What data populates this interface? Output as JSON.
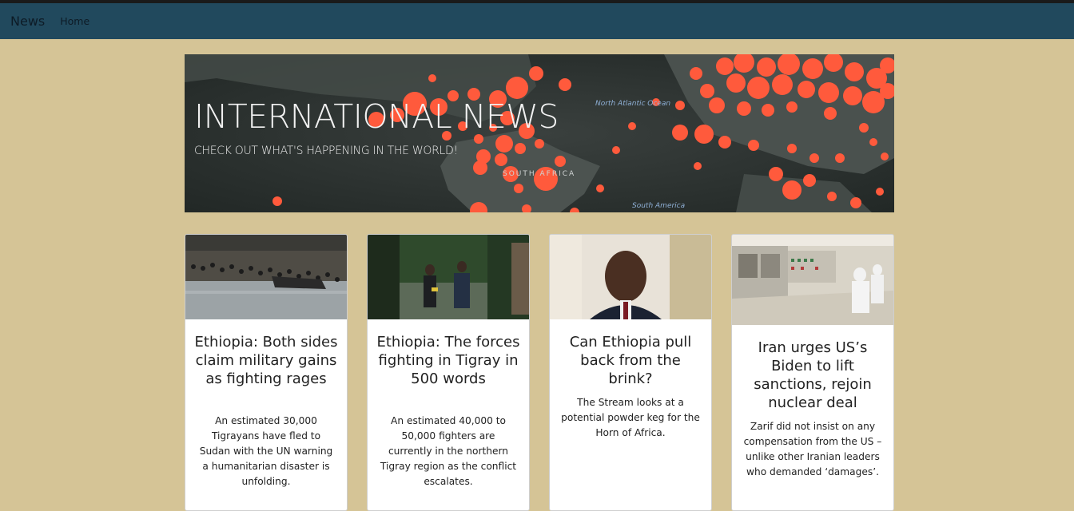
{
  "navbar": {
    "brand": "News",
    "home_label": "Home"
  },
  "hero": {
    "title": "INTERNATIONAL NEWS",
    "subtitle": "CHECK OUT WHAT'S HAPPENING IN THE WORLD!",
    "map_labels": [
      "North Atlantic Ocean",
      "SOUTH AFRICA",
      "South America"
    ]
  },
  "cards": [
    {
      "title": "Ethiopia: Both sides claim military gains as fighting rages",
      "body": "An estimated 30,000 Tigrayans have fled to Sudan with the UN warning a humanitarian disaster is unfolding."
    },
    {
      "title": "Ethiopia: The forces fighting in Tigray in 500 words",
      "body": "An estimated 40,000 to 50,000 fighters are currently in the northern Tigray region as the conflict escalates."
    },
    {
      "title": "Can Ethiopia pull back from the brink?",
      "body": "The Stream looks at a potential powder keg for the Horn of Africa."
    },
    {
      "title": "Iran urges US’s Biden to lift sanctions, rejoin nuclear deal",
      "body": "Zarif did not insist on any compensation from the US – unlike other Iranian leaders who demanded ‘damages’."
    }
  ],
  "colors": {
    "background": "#d5c496",
    "navbar": "#21495d",
    "card": "#ffffff",
    "map_dots": "#ff5a3c"
  }
}
